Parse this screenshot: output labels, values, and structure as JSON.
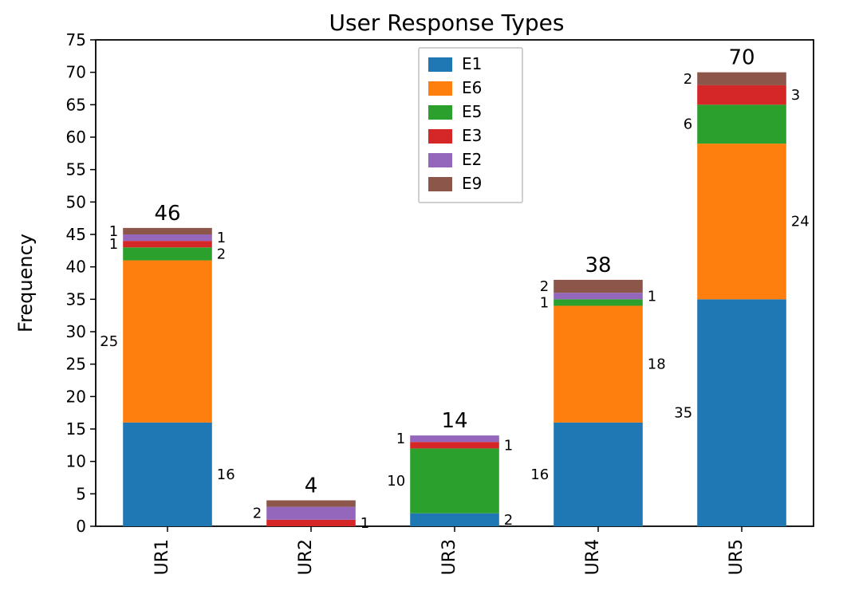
{
  "chart_data": {
    "type": "bar",
    "title": "User Response Types",
    "xlabel": "",
    "ylabel": "Frequency",
    "categories": [
      "UR1",
      "UR2",
      "UR3",
      "UR4",
      "UR5"
    ],
    "ylim": [
      0,
      75
    ],
    "yticks": [
      0,
      5,
      10,
      15,
      20,
      25,
      30,
      35,
      40,
      45,
      50,
      55,
      60,
      65,
      70,
      75
    ],
    "series": [
      {
        "name": "E1",
        "color": "#1f77b4",
        "values": [
          16,
          0,
          2,
          16,
          35
        ]
      },
      {
        "name": "E6",
        "color": "#ff7f0e",
        "values": [
          25,
          0,
          0,
          18,
          24
        ]
      },
      {
        "name": "E5",
        "color": "#2ca02c",
        "values": [
          2,
          0,
          10,
          1,
          6
        ]
      },
      {
        "name": "E3",
        "color": "#d62728",
        "values": [
          1,
          1,
          1,
          0,
          3
        ]
      },
      {
        "name": "E2",
        "color": "#9467bd",
        "values": [
          1,
          2,
          1,
          1,
          0
        ]
      },
      {
        "name": "E9",
        "color": "#8c564b",
        "values": [
          1,
          1,
          0,
          2,
          2
        ]
      }
    ],
    "totals": [
      46,
      4,
      14,
      38,
      70
    ],
    "segment_label_sides": [
      {
        "E1": "right",
        "E6": "left",
        "E5": "right",
        "E3": "left",
        "E2": "right",
        "E9": "left"
      },
      {
        "E3": "right",
        "E2": "left",
        "E9": "hidden"
      },
      {
        "E1": "right",
        "E5": "left",
        "E3": "right",
        "E2": "left"
      },
      {
        "E1": "left",
        "E6": "right",
        "E5": "left",
        "E2": "right",
        "E9": "left"
      },
      {
        "E1": "left",
        "E6": "right",
        "E5": "left",
        "E3": "right",
        "E9": "left"
      }
    ],
    "legend": {
      "position": "top-center",
      "entries": [
        "E1",
        "E6",
        "E5",
        "E3",
        "E2",
        "E9"
      ]
    }
  }
}
